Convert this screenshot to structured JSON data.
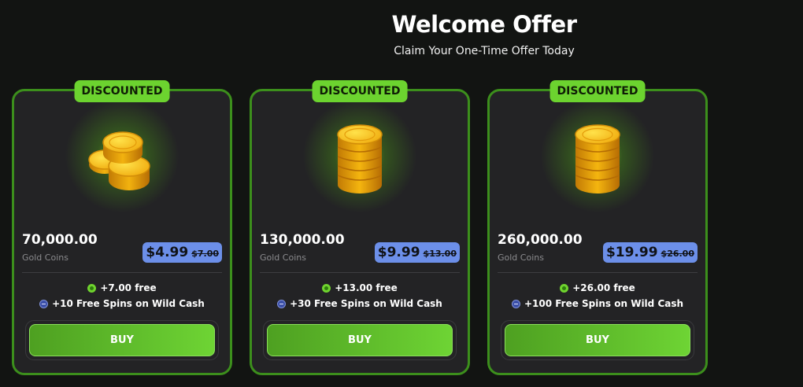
{
  "header": {
    "title": "Welcome Offer",
    "subtitle": "Claim Your One-Time Offer Today"
  },
  "colors": {
    "accent": "#6cd32f",
    "card_border": "#3c8f1c",
    "price_box": "#6c8fe9",
    "background": "#121412"
  },
  "offers": [
    {
      "badge": "DISCOUNTED",
      "image_icon": "coin-pile-icon",
      "amount": "70,000.00",
      "amount_label": "Gold Coins",
      "price": "$4.99",
      "old_price": "$7.00",
      "perk_sc": "+7.00 free",
      "perk_spins": "+10 Free Spins on Wild Cash",
      "buy_label": "BUY"
    },
    {
      "badge": "DISCOUNTED",
      "image_icon": "coin-stack-icon",
      "amount": "130,000.00",
      "amount_label": "Gold Coins",
      "price": "$9.99",
      "old_price": "$13.00",
      "perk_sc": "+13.00 free",
      "perk_spins": "+30 Free Spins on Wild Cash",
      "buy_label": "BUY"
    },
    {
      "badge": "DISCOUNTED",
      "image_icon": "coin-stack-icon",
      "amount": "260,000.00",
      "amount_label": "Gold Coins",
      "price": "$19.99",
      "old_price": "$26.00",
      "perk_sc": "+26.00 free",
      "perk_spins": "+100 Free Spins on Wild Cash",
      "buy_label": "BUY"
    }
  ]
}
